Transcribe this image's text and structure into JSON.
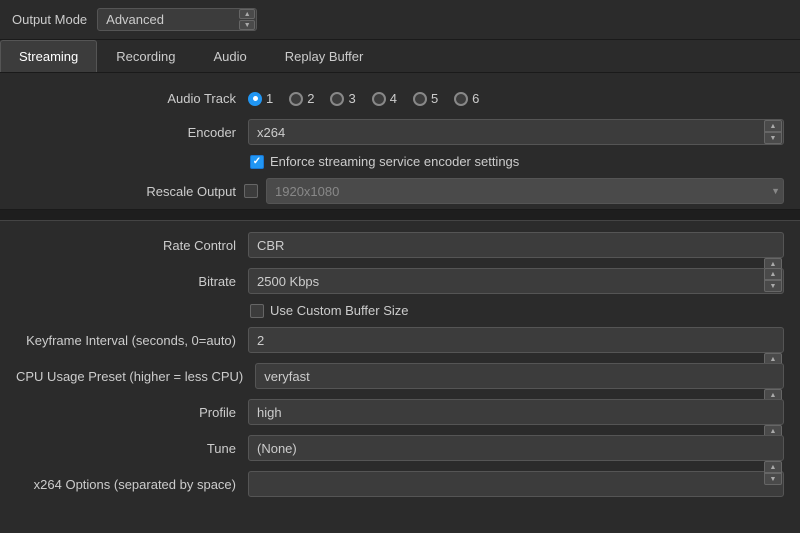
{
  "top_bar": {
    "output_mode_label": "Output Mode",
    "output_mode_value": "Advanced"
  },
  "tabs": [
    {
      "id": "streaming",
      "label": "Streaming",
      "active": true
    },
    {
      "id": "recording",
      "label": "Recording",
      "active": false
    },
    {
      "id": "audio",
      "label": "Audio",
      "active": false
    },
    {
      "id": "replay_buffer",
      "label": "Replay Buffer",
      "active": false
    }
  ],
  "streaming": {
    "audio_track_label": "Audio Track",
    "audio_tracks": [
      {
        "num": "1",
        "checked": true
      },
      {
        "num": "2",
        "checked": false
      },
      {
        "num": "3",
        "checked": false
      },
      {
        "num": "4",
        "checked": false
      },
      {
        "num": "5",
        "checked": false
      },
      {
        "num": "6",
        "checked": false
      }
    ],
    "encoder_label": "Encoder",
    "encoder_value": "x264",
    "enforce_checkbox_label": "Enforce streaming service encoder settings",
    "enforce_checked": true,
    "rescale_output_label": "Rescale Output",
    "rescale_checked": false,
    "rescale_value": "1920x1080",
    "rate_control_label": "Rate Control",
    "rate_control_value": "CBR",
    "bitrate_label": "Bitrate",
    "bitrate_value": "2500 Kbps",
    "custom_buffer_label": "Use Custom Buffer Size",
    "custom_buffer_checked": false,
    "keyframe_label": "Keyframe Interval (seconds, 0=auto)",
    "keyframe_value": "2",
    "cpu_preset_label": "CPU Usage Preset (higher = less CPU)",
    "cpu_preset_value": "veryfast",
    "profile_label": "Profile",
    "profile_value": "high",
    "tune_label": "Tune",
    "tune_value": "(None)",
    "x264_options_label": "x264 Options (separated by space)",
    "x264_options_value": ""
  }
}
